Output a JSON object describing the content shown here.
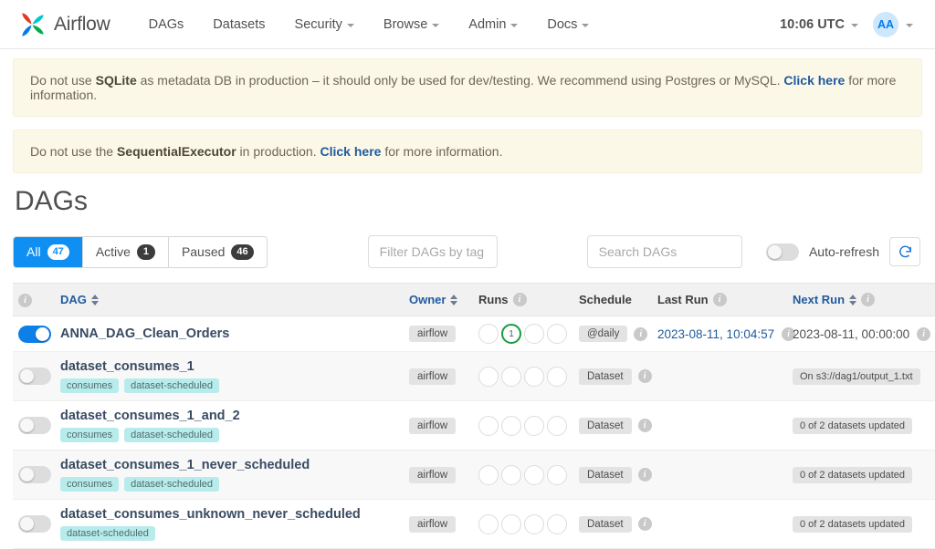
{
  "navbar": {
    "brand": "Airflow",
    "links": [
      {
        "label": "DAGs",
        "caret": false
      },
      {
        "label": "Datasets",
        "caret": false
      },
      {
        "label": "Security",
        "caret": true
      },
      {
        "label": "Browse",
        "caret": true
      },
      {
        "label": "Admin",
        "caret": true
      },
      {
        "label": "Docs",
        "caret": true
      }
    ],
    "clock": "10:06 UTC",
    "avatar_initials": "AA"
  },
  "alerts": [
    {
      "before": "Do not use ",
      "bold": "SQLite",
      "middle": " as metadata DB in production – it should only be used for dev/testing. We recommend using Postgres or MySQL. ",
      "link": "Click here",
      "after": " for more information."
    },
    {
      "before": "Do not use the ",
      "bold": "SequentialExecutor",
      "middle": " in production. ",
      "link": "Click here",
      "after": " for more information."
    }
  ],
  "page": {
    "title": "DAGs"
  },
  "filters": {
    "status_buttons": [
      {
        "label": "All",
        "count": "47",
        "active": true
      },
      {
        "label": "Active",
        "count": "1",
        "active": false
      },
      {
        "label": "Paused",
        "count": "46",
        "active": false
      }
    ],
    "tag_filter_placeholder": "Filter DAGs by tag",
    "tag_filter_value": "",
    "search_placeholder": "Search DAGs",
    "search_value": "",
    "auto_refresh_label": "Auto-refresh",
    "auto_refresh_on": false,
    "refresh_icon": "refresh-icon"
  },
  "table": {
    "columns": [
      {
        "key": "toggle",
        "label": "",
        "info": true,
        "sort": false,
        "link": false
      },
      {
        "key": "dag",
        "label": "DAG",
        "info": false,
        "sort": true,
        "link": true
      },
      {
        "key": "owner",
        "label": "Owner",
        "info": false,
        "sort": true,
        "link": true
      },
      {
        "key": "runs",
        "label": "Runs",
        "info": true,
        "sort": false,
        "link": false
      },
      {
        "key": "schedule",
        "label": "Schedule",
        "info": false,
        "sort": false,
        "link": false
      },
      {
        "key": "last_run",
        "label": "Last Run",
        "info": true,
        "sort": false,
        "link": false
      },
      {
        "key": "next_run",
        "label": "Next Run",
        "info": true,
        "sort": true,
        "link": true
      },
      {
        "key": "actions",
        "label": "",
        "info": false,
        "sort": false,
        "link": false
      }
    ],
    "rows": [
      {
        "paused": false,
        "name": "ANNA_DAG_Clean_Orders",
        "tags": [],
        "owner": "airflow",
        "runs": [
          {
            "state": "none",
            "count": ""
          },
          {
            "state": "success",
            "count": "1"
          },
          {
            "state": "none",
            "count": ""
          },
          {
            "state": "none",
            "count": ""
          }
        ],
        "schedule": "@daily",
        "last_run": "2023-08-11, 10:04:57",
        "last_run_link": true,
        "next_run": "2023-08-11, 00:00:00",
        "next_run_kind": "text"
      },
      {
        "paused": true,
        "name": "dataset_consumes_1",
        "tags": [
          "consumes",
          "dataset-scheduled"
        ],
        "owner": "airflow",
        "runs": [
          {
            "state": "none",
            "count": ""
          },
          {
            "state": "none",
            "count": ""
          },
          {
            "state": "none",
            "count": ""
          },
          {
            "state": "none",
            "count": ""
          }
        ],
        "schedule": "Dataset",
        "last_run": "",
        "last_run_link": false,
        "next_run": "On s3://dag1/output_1.txt",
        "next_run_kind": "pill"
      },
      {
        "paused": true,
        "name": "dataset_consumes_1_and_2",
        "tags": [
          "consumes",
          "dataset-scheduled"
        ],
        "owner": "airflow",
        "runs": [
          {
            "state": "none",
            "count": ""
          },
          {
            "state": "none",
            "count": ""
          },
          {
            "state": "none",
            "count": ""
          },
          {
            "state": "none",
            "count": ""
          }
        ],
        "schedule": "Dataset",
        "last_run": "",
        "last_run_link": false,
        "next_run": "0 of 2 datasets updated",
        "next_run_kind": "pill"
      },
      {
        "paused": true,
        "name": "dataset_consumes_1_never_scheduled",
        "tags": [
          "consumes",
          "dataset-scheduled"
        ],
        "owner": "airflow",
        "runs": [
          {
            "state": "none",
            "count": ""
          },
          {
            "state": "none",
            "count": ""
          },
          {
            "state": "none",
            "count": ""
          },
          {
            "state": "none",
            "count": ""
          }
        ],
        "schedule": "Dataset",
        "last_run": "",
        "last_run_link": false,
        "next_run": "0 of 2 datasets updated",
        "next_run_kind": "pill"
      },
      {
        "paused": true,
        "name": "dataset_consumes_unknown_never_scheduled",
        "tags": [
          "dataset-scheduled"
        ],
        "owner": "airflow",
        "runs": [
          {
            "state": "none",
            "count": ""
          },
          {
            "state": "none",
            "count": ""
          },
          {
            "state": "none",
            "count": ""
          },
          {
            "state": "none",
            "count": ""
          }
        ],
        "schedule": "Dataset",
        "last_run": "",
        "last_run_link": false,
        "next_run": "0 of 2 datasets updated",
        "next_run_kind": "pill"
      }
    ]
  },
  "colors": {
    "accent": "#017cee",
    "toggle_on": "#0d7fe8",
    "success": "#1a9c3e",
    "link": "#1f5a9e",
    "tag_bg": "#b8ecec",
    "alert_bg": "#fcf8e8"
  }
}
